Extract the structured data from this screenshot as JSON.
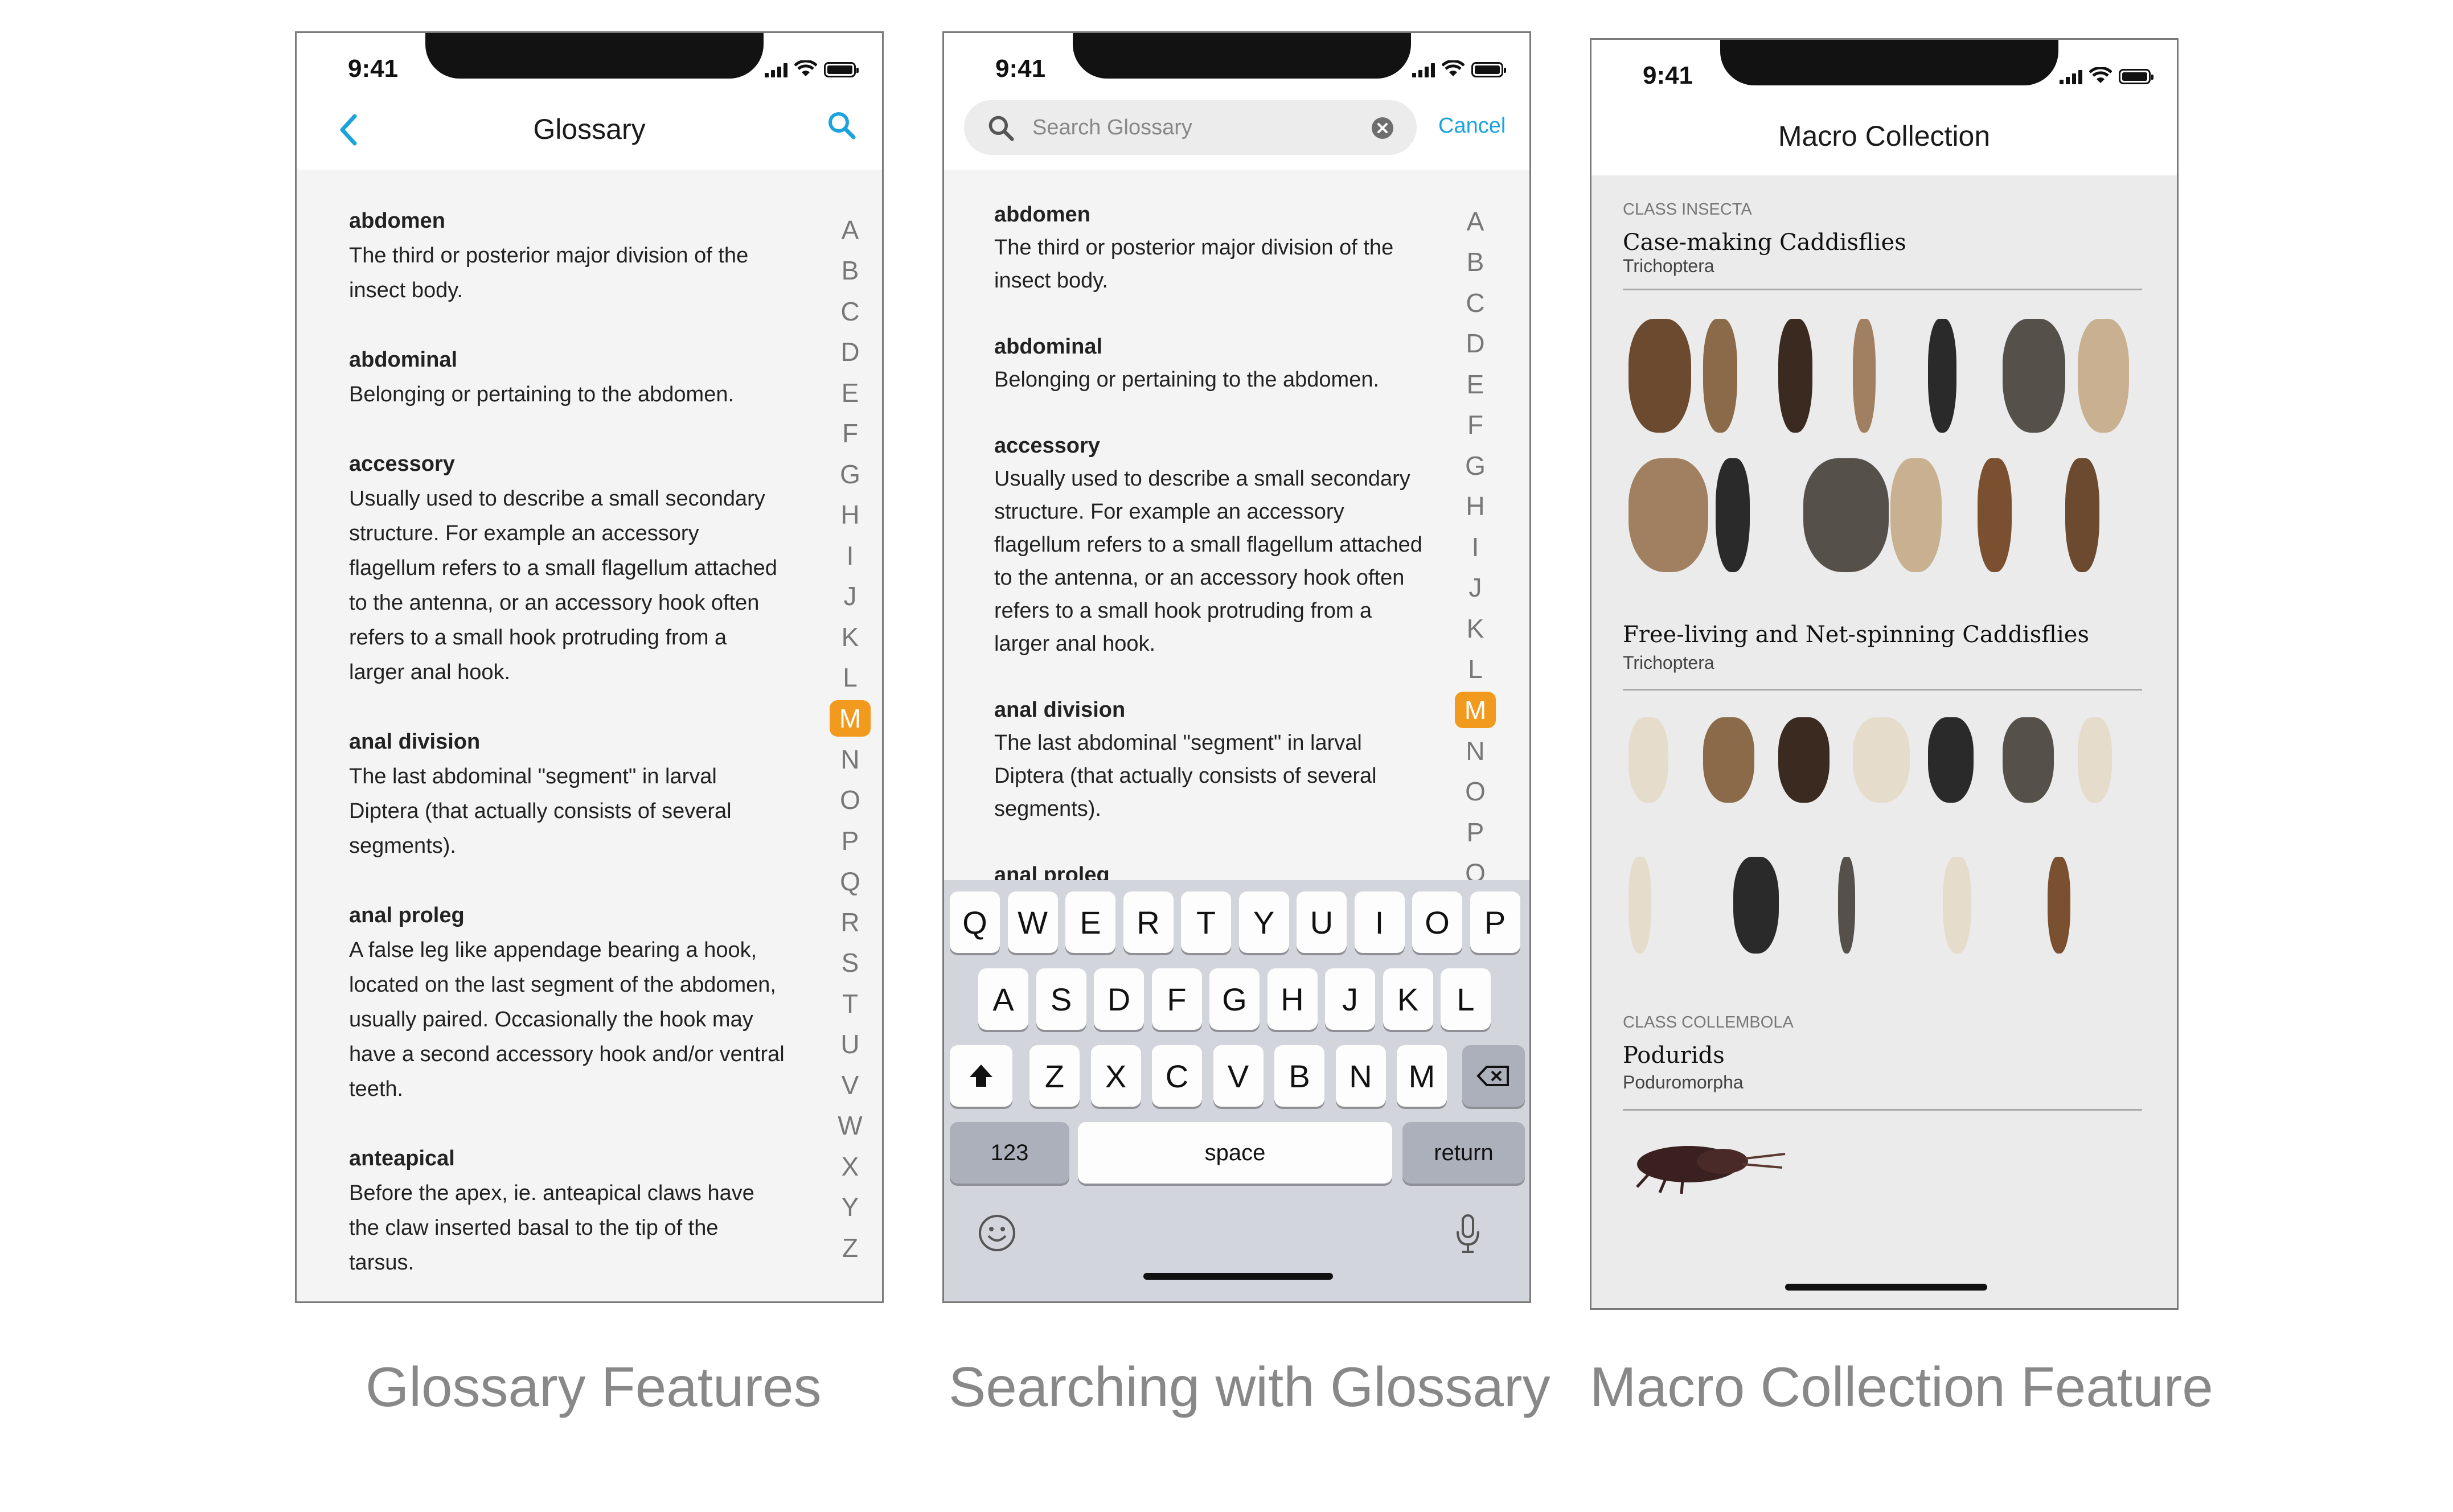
{
  "captions": [
    "Glossary Features",
    "Searching with Glossary",
    "Macro Collection Feature"
  ],
  "status_time": "9:41",
  "glossary": {
    "title": "Glossary",
    "entries": [
      {
        "term": "abdomen",
        "def": "The third or posterior major division of the\ninsect body."
      },
      {
        "term": "abdominal",
        "def": "Belonging or pertaining to the abdomen."
      },
      {
        "term": "accessory",
        "def": "Usually used to describe a small secondary\nstructure. For example an accessory\nflagellum refers to a small flagellum attached\nto the antenna, or an accessory hook often\nrefers to a small hook protruding from a\nlarger anal hook."
      },
      {
        "term": "anal division",
        "def": "The last abdominal \"segment\" in larval\nDiptera (that actually consists of several\nsegments)."
      },
      {
        "term": "anal proleg",
        "def": "A false leg like appendage bearing a hook,\nlocated on the last segment of the abdomen,\nusually paired.  Occasionally the hook may\nhave a second accessory hook and/or ventral\nteeth."
      },
      {
        "term": "anteapical",
        "def": "Before the apex, ie. anteapical claws have\nthe claw inserted basal to the tip of the\ntarsus."
      }
    ],
    "alphabet": [
      "A",
      "B",
      "C",
      "D",
      "E",
      "F",
      "G",
      "H",
      "I",
      "J",
      "K",
      "L",
      "M",
      "N",
      "O",
      "P",
      "Q",
      "R",
      "S",
      "T",
      "U",
      "V",
      "W",
      "X",
      "Y",
      "Z"
    ],
    "selected_letter": "M"
  },
  "search": {
    "placeholder": "Search Glossary",
    "cancel": "Cancel",
    "entries": [
      {
        "term": "abdomen",
        "def": "The third or posterior major division of the\ninsect body."
      },
      {
        "term": "abdominal",
        "def": "Belonging or pertaining to the abdomen."
      },
      {
        "term": "accessory",
        "def": "Usually used to describe a small secondary\nstructure. For example an accessory\nflagellum refers to a small flagellum attached\nto the antenna, or an accessory hook often\nrefers to a small hook protruding from a\nlarger anal hook."
      },
      {
        "term": "anal division",
        "def": "The last abdominal \"segment\" in larval\nDiptera (that actually consists of several\nsegments)."
      },
      {
        "term": "anal proleg",
        "def": ""
      }
    ],
    "alphabet": [
      "A",
      "B",
      "C",
      "D",
      "E",
      "F",
      "G",
      "H",
      "I",
      "J",
      "K",
      "L",
      "M",
      "N",
      "O",
      "P",
      "Q"
    ],
    "keyboard": {
      "row1": [
        "Q",
        "W",
        "E",
        "R",
        "T",
        "Y",
        "U",
        "I",
        "O",
        "P"
      ],
      "row2": [
        "A",
        "S",
        "D",
        "F",
        "G",
        "H",
        "J",
        "K",
        "L"
      ],
      "row3": [
        "Z",
        "X",
        "C",
        "V",
        "B",
        "N",
        "M"
      ],
      "numbers": "123",
      "space": "space",
      "return": "return"
    }
  },
  "macro": {
    "title": "Macro Collection",
    "sections": [
      {
        "class": "CLASS INSECTA",
        "group": "Case-making Caddisflies",
        "order": "Trichoptera"
      },
      {
        "class": "",
        "group": "Free-living and Net-spinning Caddisflies",
        "order": "Trichoptera"
      },
      {
        "class": "CLASS COLLEMBOLA",
        "group": "Podurids",
        "order": "Poduromorpha"
      }
    ]
  }
}
